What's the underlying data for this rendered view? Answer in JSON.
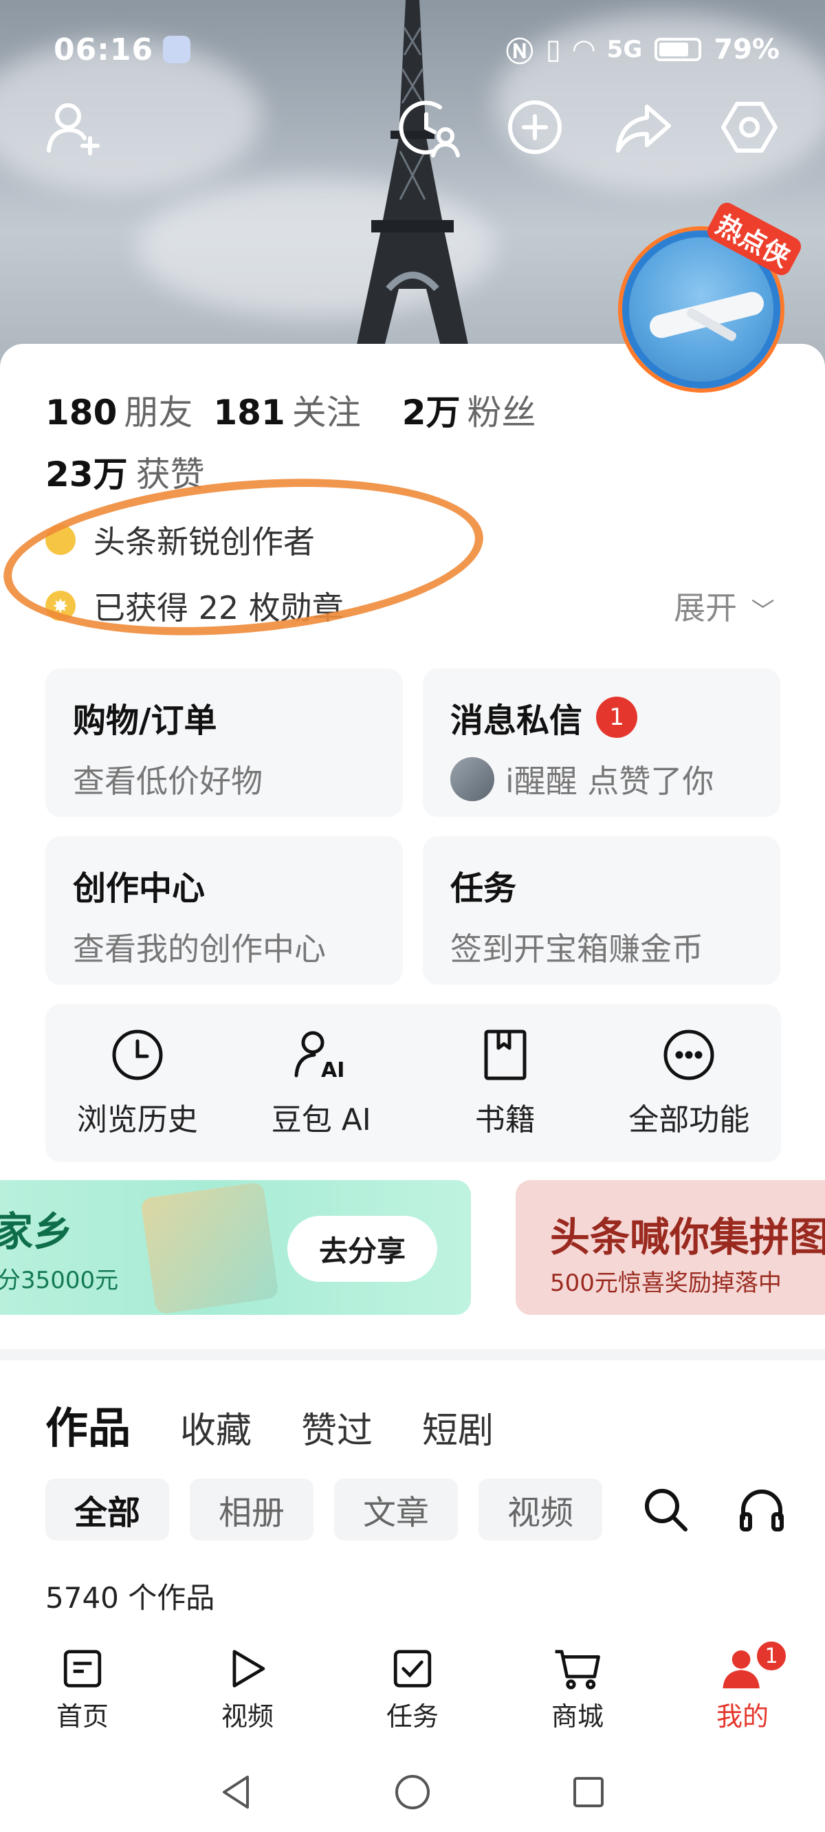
{
  "status_bar": {
    "time": "06:16",
    "signal": "5G",
    "battery": "79%"
  },
  "avatar": {
    "badge": "热点侠"
  },
  "profile": {
    "friends_count": "180",
    "friends_label": "朋友",
    "following_count": "181",
    "following_label": "关注",
    "followers_count": "2万",
    "followers_label": "粉丝",
    "likes_count": "23万",
    "likes_label": "获赞",
    "creator_title": "头条新锐创作者",
    "medals_text": "已获得 22 枚勋章",
    "expand_label": "展开"
  },
  "tiles": {
    "shopping": {
      "title": "购物/订单",
      "subtitle": "查看低价好物"
    },
    "messages": {
      "title": "消息私信",
      "badge": "1",
      "subtitle": "i醒醒 点赞了你"
    },
    "creation": {
      "title": "创作中心",
      "subtitle": "查看我的创作中心"
    },
    "tasks": {
      "title": "任务",
      "subtitle": "签到开宝箱赚金币"
    }
  },
  "shortcuts": [
    {
      "label": "浏览历史",
      "icon": "clock-icon"
    },
    {
      "label": "豆包 AI",
      "icon": "ai-assistant-icon"
    },
    {
      "label": "书籍",
      "icon": "book-icon"
    },
    {
      "label": "全部功能",
      "icon": "more-icon"
    }
  ],
  "banners": {
    "left": {
      "title": "家乡",
      "subtitle": "分35000元",
      "button": "去分享"
    },
    "right": {
      "title": "头条喊你集拼图",
      "subtitle": "500元惊喜奖励掉落中"
    }
  },
  "works": {
    "tabs": [
      "作品",
      "收藏",
      "赞过",
      "短剧"
    ],
    "chips": [
      "全部",
      "相册",
      "文章",
      "视频"
    ],
    "count_text": "5740 个作品"
  },
  "nav": {
    "items": [
      {
        "label": "首页",
        "icon": "home-icon"
      },
      {
        "label": "视频",
        "icon": "play-icon"
      },
      {
        "label": "任务",
        "icon": "task-icon"
      },
      {
        "label": "商城",
        "icon": "cart-icon"
      },
      {
        "label": "我的",
        "icon": "profile-icon",
        "badge": "1"
      }
    ]
  },
  "colors": {
    "accent_red": "#e5362d",
    "annotation_orange": "#f08b3a",
    "banner_green": "#b8f0dc",
    "banner_pink": "#f5d8d6"
  }
}
